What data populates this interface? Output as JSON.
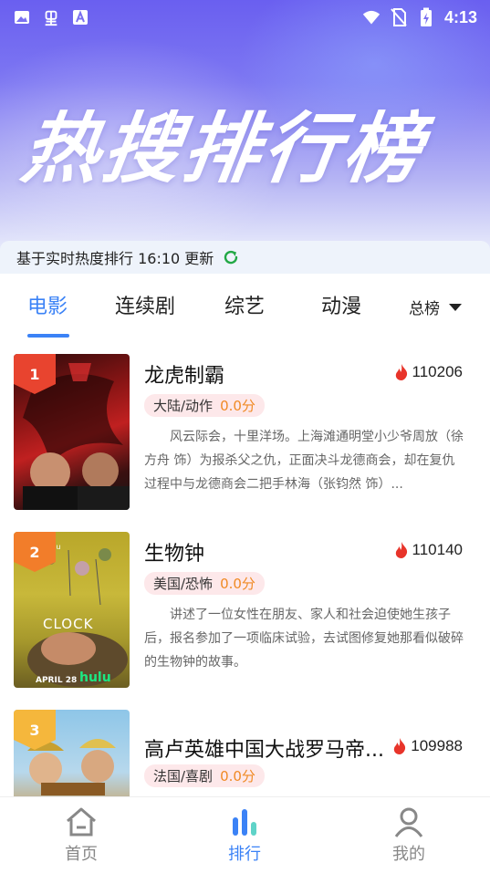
{
  "status_bar": {
    "time": "4:13"
  },
  "header": {
    "title": "热搜排行榜"
  },
  "update_bar": {
    "text": "基于实时热度排行 16:10 更新"
  },
  "tabs": [
    {
      "label": "电影",
      "active": true
    },
    {
      "label": "连续剧",
      "active": false
    },
    {
      "label": "综艺",
      "active": false
    },
    {
      "label": "动漫",
      "active": false
    }
  ],
  "rank_selector": {
    "label": "总榜"
  },
  "items": [
    {
      "rank": "1",
      "title": "龙虎制霸",
      "heat": "110206",
      "genre": "大陆/动作",
      "score": "0.0分",
      "desc": "风云际会，十里洋场。上海滩通明堂小少爷周放（徐方舟 饰）为报杀父之仇，正面决斗龙德商会，却在复仇过程中与龙德商会二把手林海（张钧然 饰）..."
    },
    {
      "rank": "2",
      "title": "生物钟",
      "heat": "110140",
      "genre": "美国/恐怖",
      "score": "0.0分",
      "desc": "讲述了一位女性在朋友、家人和社会迫使她生孩子后，报名参加了一项临床试验，去试图修复她那看似破碎的生物钟的故事。",
      "poster_text": {
        "top": "hulu",
        "title": "CLOCK",
        "date": "APRIL 28",
        "brand": "hulu"
      }
    },
    {
      "rank": "3",
      "title": "高卢英雄中国大战罗马帝...",
      "heat": "109988",
      "genre": "法国/喜剧",
      "score": "0.0分",
      "desc": ""
    }
  ],
  "bottom_nav": [
    {
      "label": "首页",
      "icon": "home-icon",
      "active": false
    },
    {
      "label": "排行",
      "icon": "ranking-icon",
      "active": true
    },
    {
      "label": "我的",
      "icon": "profile-icon",
      "active": false
    }
  ],
  "colors": {
    "accent": "#3b82f6",
    "rank1": "#e8442f",
    "rank2": "#f27d2a",
    "rank3": "#f5b73c",
    "heat_icon": "#e8342a",
    "score": "#f08a24",
    "tag_bg": "#fde8ea"
  }
}
